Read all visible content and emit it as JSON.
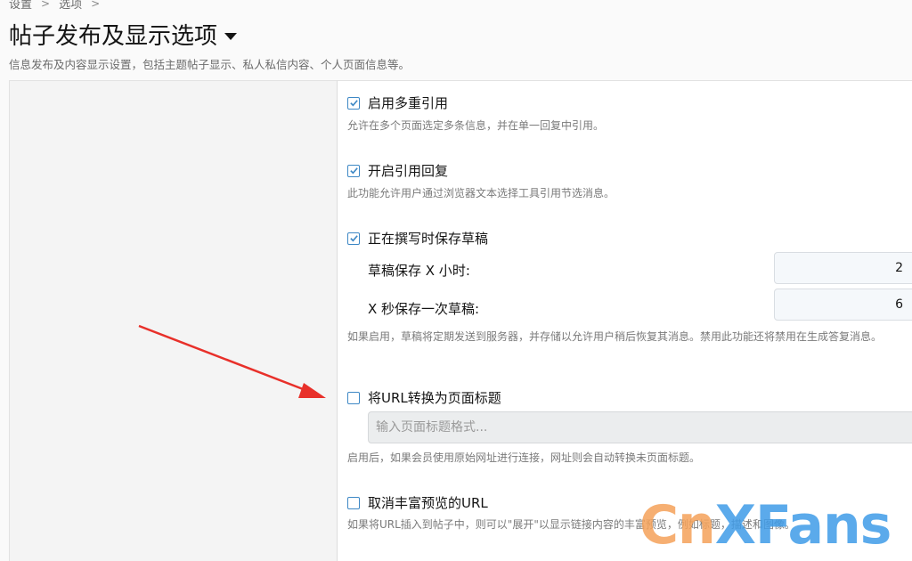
{
  "breadcrumb": {
    "items": [
      "设置",
      "选项"
    ]
  },
  "header": {
    "title": "帖子发布及显示选项",
    "description": "信息发布及内容显示设置，包括主题帖子显示、私人私信内容、个人页面信息等。"
  },
  "options": {
    "multi_quote": {
      "label": "启用多重引用",
      "checked": true,
      "hint": "允许在多个页面选定多条信息，并在单一回复中引用。"
    },
    "quote_reply": {
      "label": "开启引用回复",
      "checked": true,
      "hint": "此功能允许用户通过浏览器文本选择工具引用节选消息。"
    },
    "save_draft": {
      "label": "正在撰写时保存草稿",
      "checked": true,
      "hours_label": "草稿保存 X 小时:",
      "hours_value": "2",
      "seconds_label": "X 秒保存一次草稿:",
      "seconds_value": "6",
      "hint": "如果启用，草稿将定期发送到服务器，并存储以允许用户稍后恢复其消息。禁用此功能还将禁用在生成答复消息。"
    },
    "url_to_title": {
      "label": "将URL转换为页面标题",
      "checked": false,
      "placeholder": "输入页面标题格式...",
      "hint": "启用后，如果会员使用原始网址进行连接，网址则会自动转换未页面标题。"
    },
    "unfurl_url": {
      "label": "取消丰富预览的URL",
      "checked": false,
      "hint": "如果将URL插入到帖子中，则可以\"展开\"以显示链接内容的丰富预览，例如标题，描述和图像。"
    }
  },
  "watermark": {
    "part1": "Cn",
    "part2": "XFans"
  },
  "colors": {
    "checkbox": "#3e88c5",
    "arrow": "#e8302a",
    "watermark_orange": "#f5a25a",
    "watermark_blue": "#3f9ce8"
  }
}
